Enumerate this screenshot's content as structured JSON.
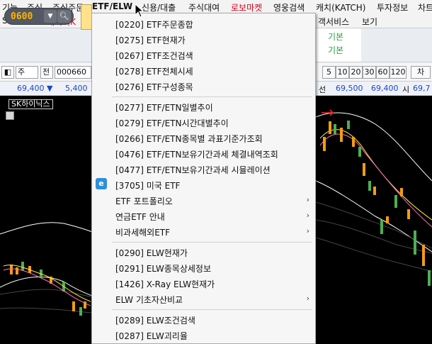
{
  "menubar": {
    "items": [
      "기능",
      "주식",
      "주식주문",
      "ETF/ELW",
      "신용/대출",
      "주식대여",
      "로보마켓",
      "영웅검색",
      "캐치(KATCH)",
      "투자정보",
      "차트"
    ]
  },
  "menubar2": {
    "items": [
      "SPECIAL",
      "데이터K",
      "E",
      "객서비스",
      "보기"
    ]
  },
  "toolbar": {
    "stock_code": "0600",
    "basic_line1": "기본",
    "basic_line2": "기본"
  },
  "ctrlrow": {
    "arrow": "◧",
    "market": "주",
    "type": "전",
    "stock_code": "000660",
    "periods": [
      "5",
      "10",
      "20",
      "30",
      "60",
      "120"
    ],
    "period_suffix": "차"
  },
  "pricerow": {
    "price_left": "69,400",
    "change_arrow": "▼",
    "change": "5,400",
    "price_label": "선",
    "open": "69,500",
    "high": "69,400",
    "close_label": "시",
    "close": "69,7"
  },
  "chart": {
    "title": "SK하이닉스"
  },
  "dropdown": {
    "items": [
      {
        "label": "[0220] ETF주문종합"
      },
      {
        "label": "[0275] ETF현재가"
      },
      {
        "label": "[0267] ETF조건검색"
      },
      {
        "label": "[0278] ETF전체시세"
      },
      {
        "label": "[0276] ETF구성종목"
      },
      {
        "label": "[0277] ETF/ETN일별추이"
      },
      {
        "label": "[0279] ETF/ETN시간대별추이"
      },
      {
        "label": "[0266] ETF/ETN종목별 과표기준가조회"
      },
      {
        "label": "[0476] ETF/ETN보유기간과세 체결내역조회"
      },
      {
        "label": "[0477] ETF/ETN보유기간과세 시뮬레이션"
      },
      {
        "label": "[3705] 미국 ETF"
      },
      {
        "label": "ETF 포트폴리오"
      },
      {
        "label": "연금ETF 안내"
      },
      {
        "label": "비과세해외ETF"
      },
      {
        "label": "[0290] ELW현재가"
      },
      {
        "label": "[0291] ELW종목상세정보"
      },
      {
        "label": "[1426] X-Ray ELW현재가"
      },
      {
        "label": "ELW 기초자산비교"
      },
      {
        "label": "[0289] ELW조건검색"
      },
      {
        "label": "[0287] ELW괴리율"
      }
    ],
    "submenu_arrow": "›",
    "icon_letter": "e"
  }
}
